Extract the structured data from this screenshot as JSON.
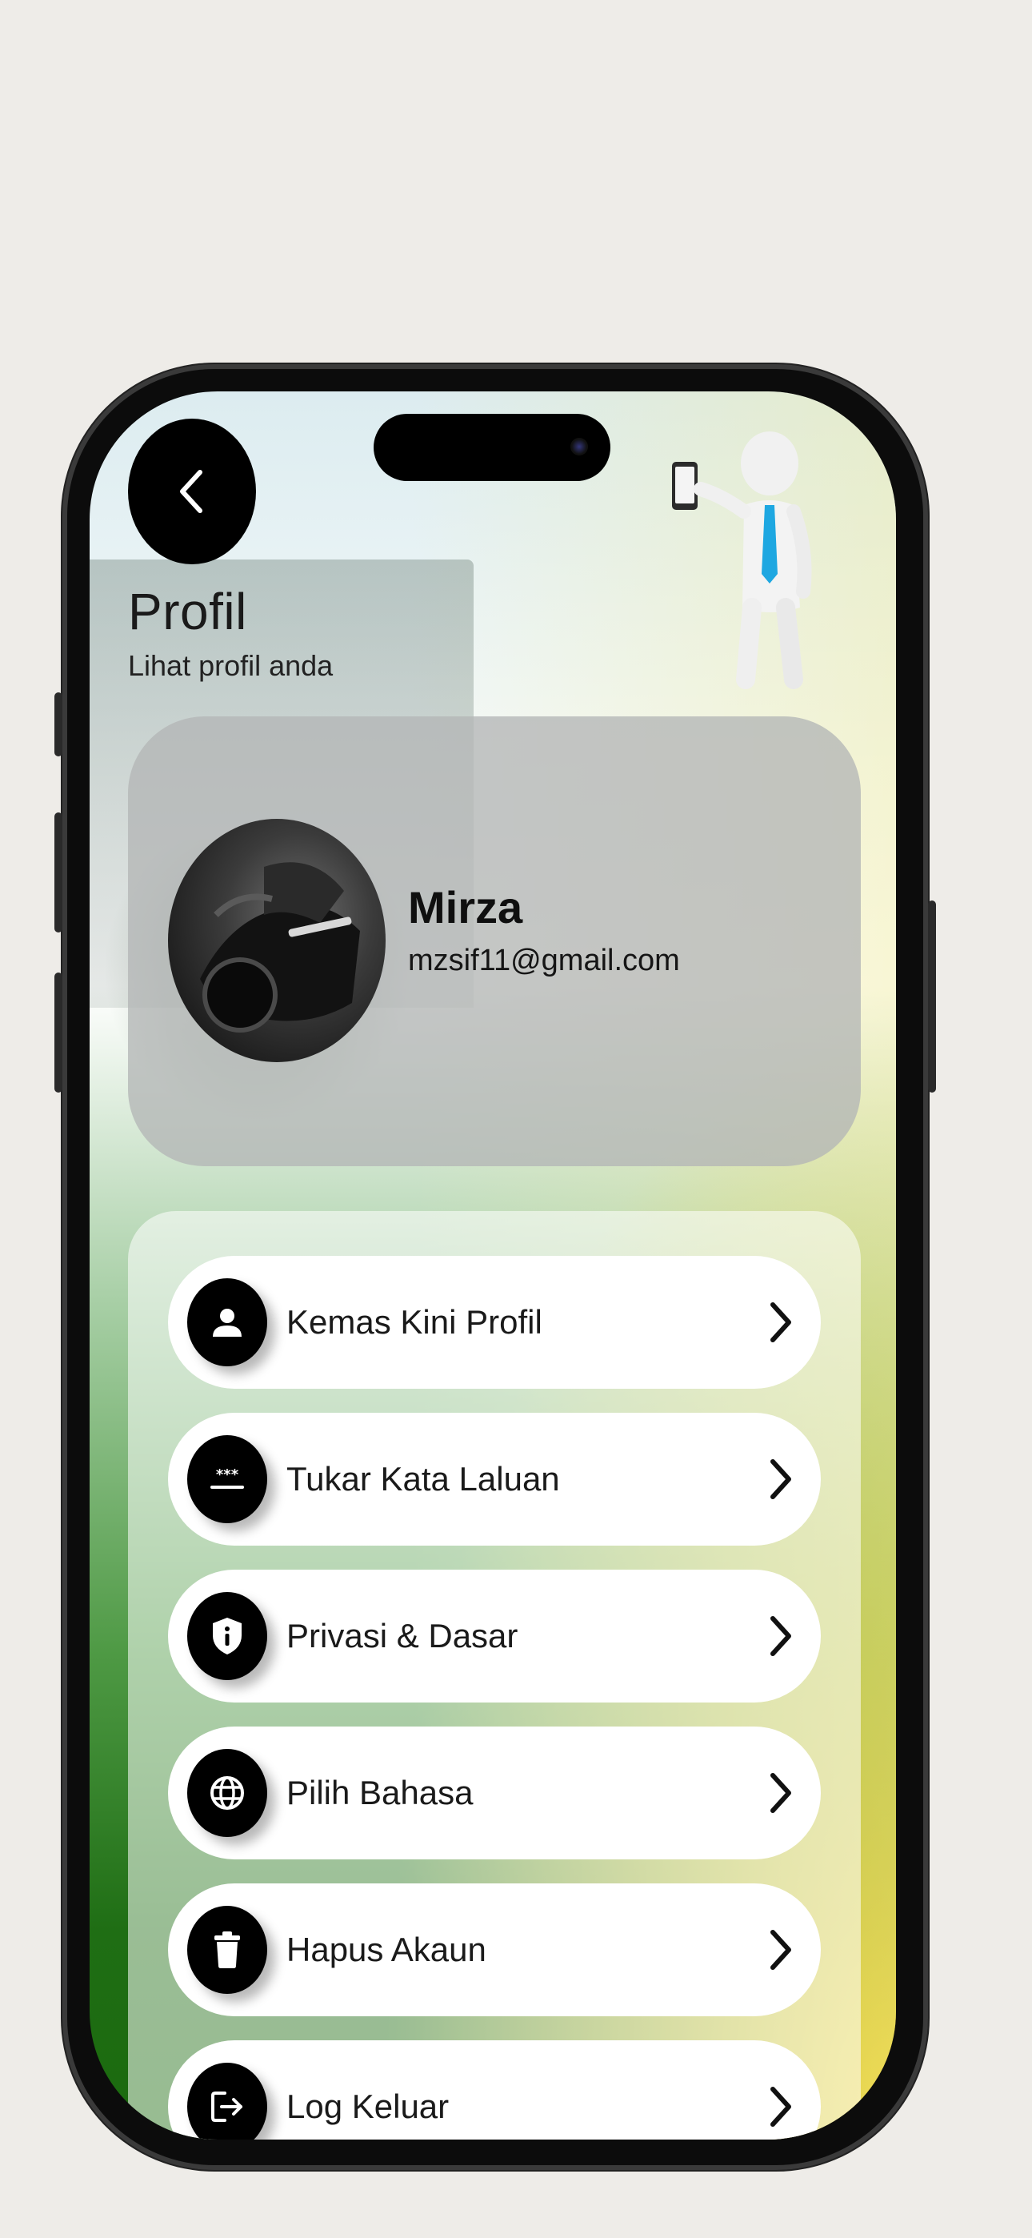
{
  "header": {
    "title": "Profil",
    "subtitle": "Lihat profil anda",
    "back_icon": "chevron-left-icon"
  },
  "profile": {
    "name": "Mirza",
    "email": "mzsif11@gmail.com"
  },
  "menu": {
    "items": [
      {
        "label": "Kemas Kini Profil",
        "icon": "person-icon"
      },
      {
        "label": "Tukar Kata Laluan",
        "icon": "password-icon"
      },
      {
        "label": "Privasi & Dasar",
        "icon": "shield-info-icon"
      },
      {
        "label": "Pilih Bahasa",
        "icon": "globe-icon"
      },
      {
        "label": "Hapus Akaun",
        "icon": "trash-icon"
      },
      {
        "label": "Log Keluar",
        "icon": "logout-icon"
      }
    ]
  },
  "colors": {
    "accent_yellow": "#f4d11b",
    "accent_green": "#1b6a0e",
    "icon_bg": "#000000",
    "tie_blue": "#1ea7e1"
  }
}
